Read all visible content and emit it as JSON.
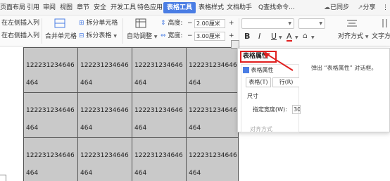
{
  "menubar": {
    "items": [
      "页面布局",
      "引用",
      "审阅",
      "视图",
      "章节",
      "安全",
      "开发工具",
      "特色应用",
      "表格工具",
      "表格样式",
      "文档助手"
    ],
    "search": "Q查找命令...",
    "sync": "已同步",
    "share": "分享",
    "active_color": "#4a7de4"
  },
  "ribbon": {
    "insert_left": "在左侧插入列",
    "insert_right": "在右侧插入列",
    "merge_cells": "合并单元格",
    "split_cell": "拆分单元格",
    "split_table": "拆分表格",
    "auto_adjust": "自动调整",
    "height_label": "高度:",
    "height_value": "2.00厘米",
    "width_label": "宽度:",
    "width_value": "3.00厘米",
    "bold": "B",
    "italic": "I",
    "underline": "U",
    "font_color": "A",
    "align": "对齐方式",
    "text_dir": "文字方"
  },
  "table": {
    "rows": [
      [
        "122231234646",
        "122231234646",
        "122231234646",
        "122231234646"
      ],
      [
        "464",
        "464",
        "464",
        "464"
      ],
      [
        "122231234646",
        "122231234646",
        "122231234646",
        "122231234646"
      ],
      [
        "464",
        "464",
        "464",
        "464"
      ],
      [
        "122231234646",
        "122231234646",
        "122231234646",
        "122231234646"
      ],
      [
        "464",
        "464",
        "464",
        "464"
      ]
    ],
    "fill_color": "#c9c9c9"
  },
  "popup": {
    "title": "表格属性",
    "description": "弹出 “表格属性” 对话框。",
    "mini_title": "表格属性",
    "tab_table": "表格(T)",
    "tab_row": "行(R)",
    "size_label": "尺寸",
    "width_label": "指定宽度(W):",
    "width_value": "30",
    "align_label": "对齐方式",
    "highlight_color": "#e02020"
  }
}
